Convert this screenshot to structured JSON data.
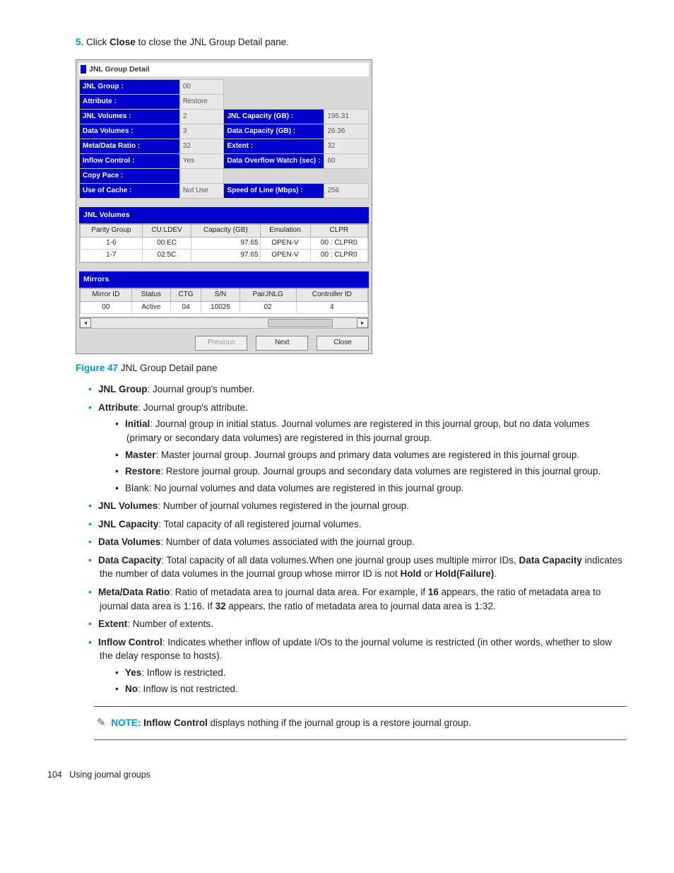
{
  "step": {
    "num": "5.",
    "pre": "Click ",
    "bold": "Close",
    "post": " to close the JNL Group Detail pane."
  },
  "panel": {
    "title": "JNL Group Detail",
    "rows": {
      "jnl_group_l": "JNL Group :",
      "jnl_group_v": "00",
      "attr_l": "Attribute :",
      "attr_v": "Restore",
      "jnlv_l": "JNL Volumes :",
      "jnlv_v": "2",
      "jnlc_l": "JNL Capacity (GB) :",
      "jnlc_v": "195.31",
      "dv_l": "Data Volumes :",
      "dv_v": "3",
      "dc_l": "Data Capacity (GB) :",
      "dc_v": "26.36",
      "mr_l": "Meta/Data Ratio :",
      "mr_v": "32",
      "ext_l": "Extent :",
      "ext_v": "32",
      "ic_l": "Inflow Control :",
      "ic_v": "Yes",
      "dow_l": "Data Overflow Watch (sec) :",
      "dow_v": "60",
      "cp_l": "Copy Pace :",
      "cp_v": "",
      "uc_l": "Use of Cache :",
      "uc_v": "Not Use",
      "sl_l": "Speed of Line (Mbps) :",
      "sl_v": "256"
    },
    "jnlv_header": "JNL Volumes",
    "jnlv_cols": {
      "pg": "Parity Group",
      "cl": "CU:LDEV",
      "cap": "Capacity (GB)",
      "emu": "Emulation",
      "clpr": "CLPR"
    },
    "jnlv_rows": [
      {
        "pg": "1-6",
        "cl": "00:EC",
        "cap": "97.65",
        "emu": "OPEN-V",
        "clpr": "00 : CLPR0"
      },
      {
        "pg": "1-7",
        "cl": "02:5C",
        "cap": "97.65",
        "emu": "OPEN-V",
        "clpr": "00 : CLPR0"
      }
    ],
    "mir_header": "Mirrors",
    "mir_cols": {
      "mid": "Mirror ID",
      "st": "Status",
      "ctg": "CTG",
      "sn": "S/N",
      "pj": "PairJNLG",
      "cid": "Controller ID"
    },
    "mir_rows": [
      {
        "mid": "00",
        "st": "Active",
        "ctg": "04",
        "sn": "10026",
        "pj": "02",
        "cid": "4"
      }
    ],
    "btn_prev": "Previous",
    "btn_next": "Next",
    "btn_close": "Close"
  },
  "caption": {
    "label": "Figure 47",
    "text": " JNL Group Detail pane"
  },
  "bullets": {
    "b1a": "JNL Group",
    "b1b": ": Journal group's number.",
    "b2a": "Attribute",
    "b2b": ": Journal group's attribute.",
    "b2_1a": "Initial",
    "b2_1b": ": Journal group in initial status. Journal volumes are registered in this journal group, but no data volumes (primary or secondary data volumes) are registered in this journal group.",
    "b2_2a": "Master",
    "b2_2b": ": Master journal group. Journal groups and primary data volumes are registered in this journal group.",
    "b2_3a": "Restore",
    "b2_3b": ": Restore journal group. Journal groups and secondary data volumes are registered in this journal group.",
    "b2_4": "Blank: No journal volumes and data volumes are registered in this journal group.",
    "b3a": "JNL Volumes",
    "b3b": ": Number of journal volumes registered in the journal group.",
    "b4a": "JNL Capacity",
    "b4b": ": Total capacity of all registered journal volumes.",
    "b5a": "Data Volumes",
    "b5b": ": Number of data volumes associated with the journal group.",
    "b6a": "Data Capacity",
    "b6b": ": Total capacity of all data volumes.When one journal group uses multiple mirror IDs, ",
    "b6c": "Data Capacity",
    "b6d": " indicates the number of data volumes in the journal group whose mirror ID is not ",
    "b6e": "Hold",
    "b6f": " or ",
    "b6g": "Hold(Failure)",
    "b6h": ".",
    "b7a": "Meta/Data Ratio",
    "b7b": ": Ratio of metadata area to journal data area. For example, if ",
    "b7c": "16",
    "b7d": " appears, the ratio of metadata area to journal data area is 1:16. If ",
    "b7e": "32",
    "b7f": " appears, the ratio of metadata area to journal data area is 1:32.",
    "b8a": "Extent",
    "b8b": ": Number of extents.",
    "b9a": "Inflow Control",
    "b9b": ": Indicates whether inflow of update I/Os to the journal volume is restricted (in other words, whether to slow the delay response to hosts).",
    "b9_1a": "Yes",
    "b9_1b": ": Inflow is restricted.",
    "b9_2a": "No",
    "b9_2b": ": Inflow is not restricted."
  },
  "note": {
    "label": "NOTE:",
    "pre": "   ",
    "bold": "Inflow Control",
    "post": " displays nothing if the journal group is a restore journal group."
  },
  "footer": {
    "page": "104",
    "title": "Using journal groups"
  }
}
